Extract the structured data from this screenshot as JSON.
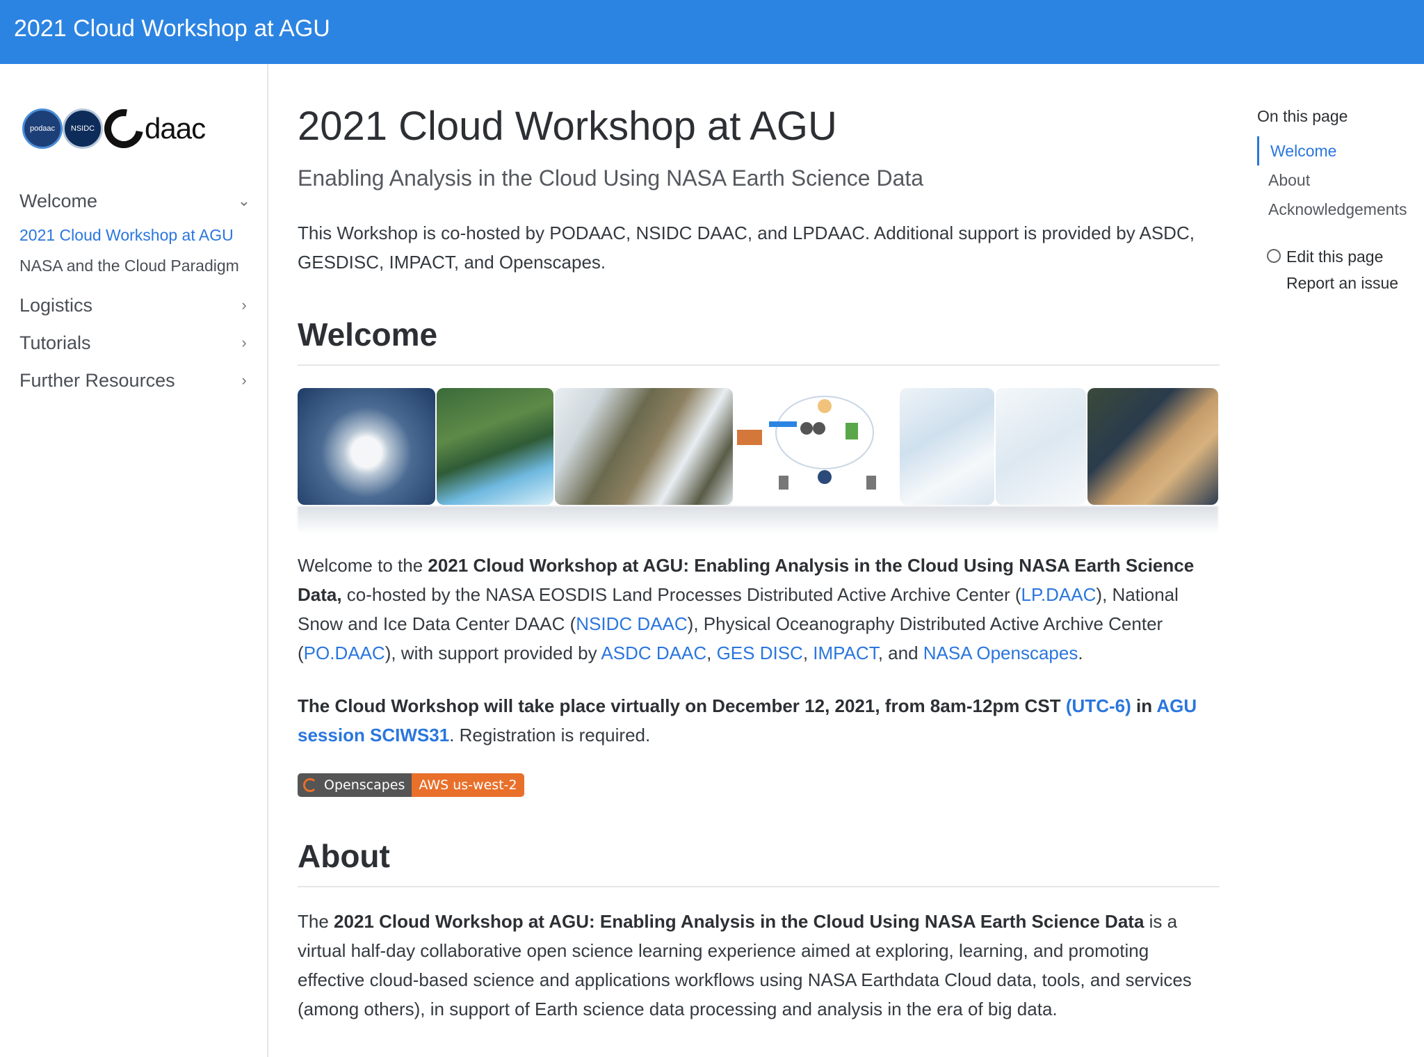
{
  "topbar": {
    "title": "2021 Cloud Workshop at AGU"
  },
  "logos": {
    "podaac": "podaac",
    "nsidc": "NSIDC",
    "lpdaac": "daac"
  },
  "sidebar": {
    "groups": [
      {
        "label": "Welcome",
        "expanded": true,
        "items": [
          {
            "label": "2021 Cloud Workshop at AGU",
            "active": true
          },
          {
            "label": "NASA and the Cloud Paradigm",
            "active": false
          }
        ]
      },
      {
        "label": "Logistics"
      },
      {
        "label": "Tutorials"
      },
      {
        "label": "Further Resources"
      }
    ]
  },
  "main": {
    "title": "2021 Cloud Workshop at AGU",
    "subtitle": "Enabling Analysis in the Cloud Using NASA Earth Science Data",
    "intro": "This Workshop is co-hosted by PODAAC, NSIDC DAAC, and LPDAAC. Additional support is provided by ASDC, GESDISC, IMPACT, and Openscapes.",
    "welcome_heading": "Welcome",
    "welcome": {
      "p1_pre": "Welcome to the ",
      "p1_bold": "2021 Cloud Workshop at AGU: Enabling Analysis in the Cloud Using NASA Earth Science Data,",
      "p1_mid1": " co-hosted by the NASA EOSDIS Land Processes Distributed Active Archive Center (",
      "link_lpdaac": "LP.DAAC",
      "p1_mid2": "), National Snow and Ice Data Center DAAC (",
      "link_nsidc": "NSIDC DAAC",
      "p1_mid3": "), Physical Oceanography Distributed Active Archive Center (",
      "link_podaac": "PO.DAAC",
      "p1_mid4": "), with support provided by ",
      "link_asdc": "ASDC DAAC",
      "comma1": ", ",
      "link_gesdisc": "GES DISC",
      "comma2": ", ",
      "link_impact": "IMPACT",
      "and": ", and ",
      "link_openscapes": "NASA Openscapes",
      "period": ".",
      "p2_bold": "The Cloud Workshop will take place virtually on December 12, 2021, from 8am-12pm CST ",
      "link_utc": "(UTC-6)",
      "p2_in": " in ",
      "link_session": "AGU session SCIWS31",
      "p2_rest": ". Registration is required."
    },
    "badge": {
      "left": "Openscapes",
      "right": "AWS us-west-2"
    },
    "about_heading": "About",
    "about": {
      "pre": "The ",
      "bold": "2021 Cloud Workshop at AGU: Enabling Analysis in the Cloud Using NASA Earth Science Data",
      "rest": " is a virtual half-day collaborative open science learning experience aimed at exploring, learning, and promoting effective cloud-based science and applications workflows using NASA Earthdata Cloud data, tools, and services (among others), in support of Earth science data processing and analysis in the era of big data."
    }
  },
  "toc": {
    "heading": "On this page",
    "items": [
      {
        "label": "Welcome",
        "active": true
      },
      {
        "label": "About",
        "active": false
      },
      {
        "label": "Acknowledgements",
        "active": false
      }
    ],
    "edit": "Edit this page",
    "report": "Report an issue"
  }
}
